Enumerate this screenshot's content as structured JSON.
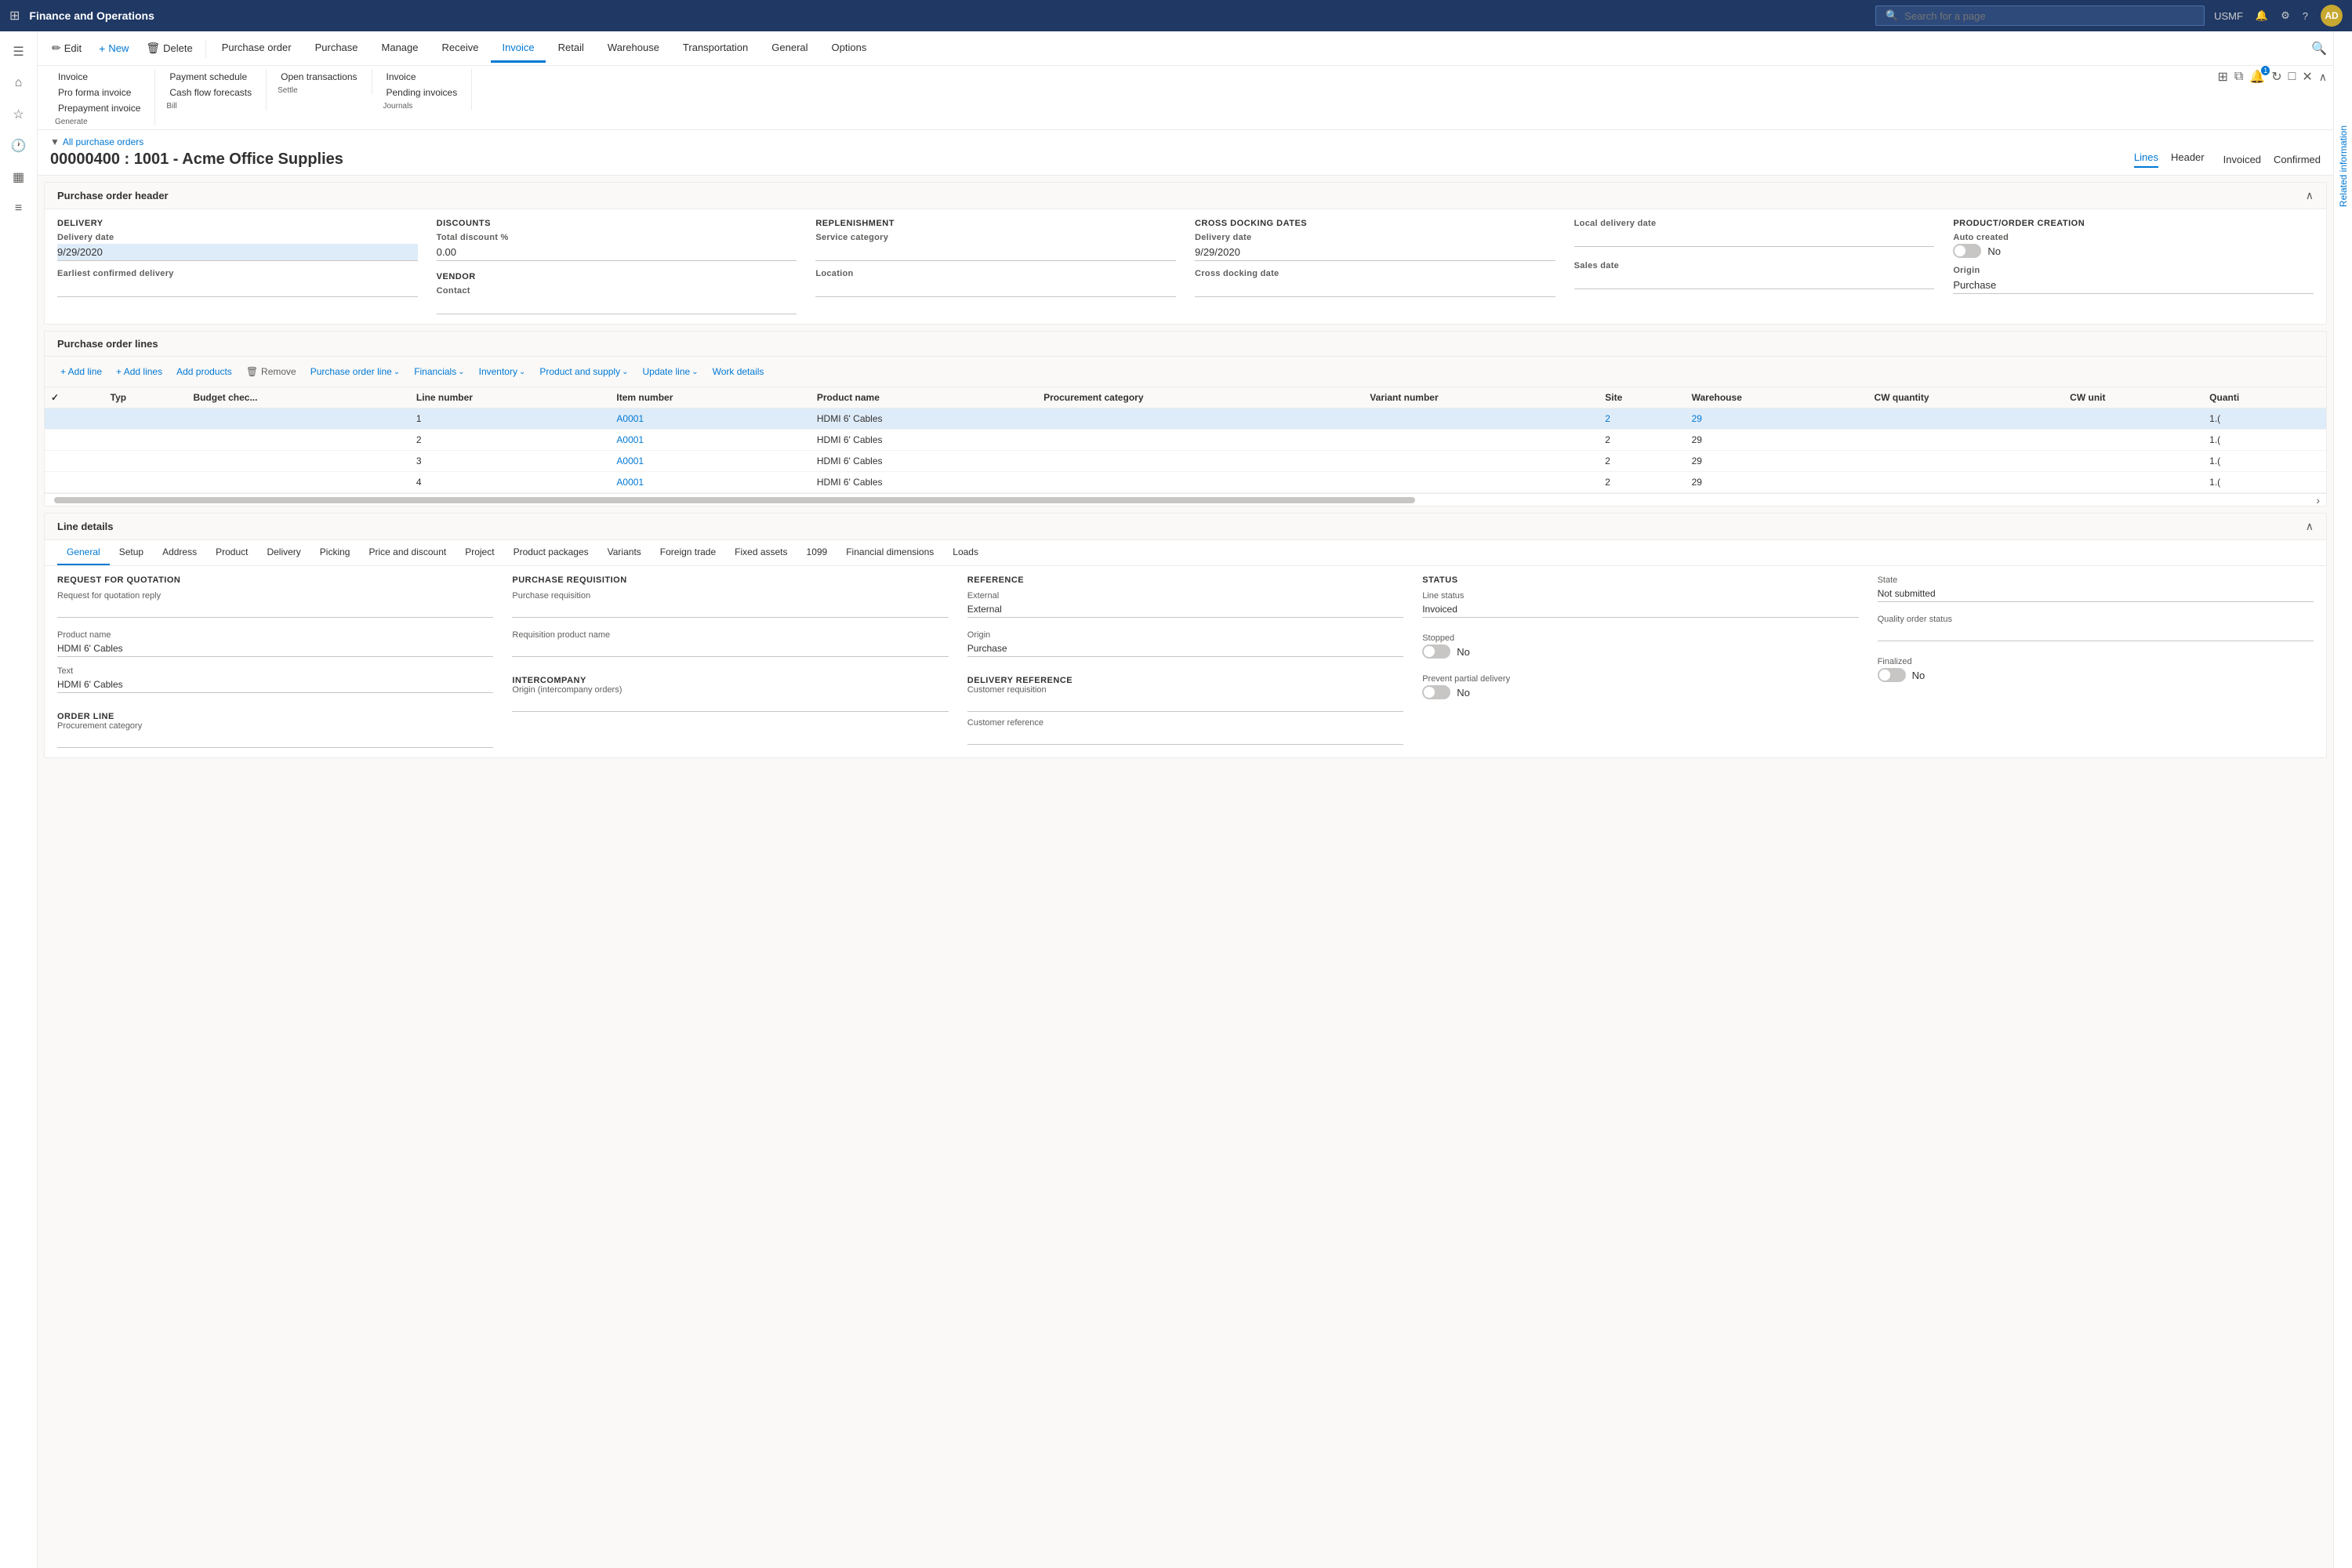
{
  "app": {
    "title": "Finance and Operations",
    "environment": "USMF"
  },
  "search": {
    "placeholder": "Search for a page"
  },
  "command_bar": {
    "edit": "Edit",
    "new": "New",
    "delete": "Delete",
    "purchase_order": "Purchase order",
    "purchase": "Purchase",
    "manage": "Manage",
    "receive": "Receive",
    "invoice": "Invoice",
    "retail": "Retail",
    "warehouse": "Warehouse",
    "transportation": "Transportation",
    "general": "General",
    "options": "Options"
  },
  "ribbon": {
    "groups": [
      {
        "label": "Generate",
        "items": [
          "Invoice",
          "Pro forma invoice",
          "Prepayment invoice"
        ]
      },
      {
        "label": "Bill",
        "items": [
          "Payment schedule",
          "Cash flow forecasts"
        ]
      },
      {
        "label": "Settle",
        "items": [
          "Open transactions"
        ]
      },
      {
        "label": "Journals",
        "items": [
          "Invoice",
          "Pending invoices"
        ]
      }
    ]
  },
  "breadcrumb": "All purchase orders",
  "page_title": "00000400 : 1001 - Acme Office Supplies",
  "title_tabs": [
    "Lines",
    "Header"
  ],
  "status": {
    "invoiced": "Invoiced",
    "confirmed": "Confirmed"
  },
  "purchase_order_header": {
    "title": "Purchase order header",
    "delivery": {
      "label": "DELIVERY",
      "delivery_date_label": "Delivery date",
      "delivery_date_value": "9/29/2020",
      "earliest_confirmed_label": "Earliest confirmed delivery"
    },
    "discounts": {
      "label": "DISCOUNTS",
      "total_discount_label": "Total discount %",
      "total_discount_value": "0.00"
    },
    "vendor": {
      "label": "VENDOR",
      "contact_label": "Contact"
    },
    "replenishment": {
      "label": "REPLENISHMENT",
      "service_category_label": "Service category",
      "location_label": "Location"
    },
    "cross_docking": {
      "label": "CROSS DOCKING DATES",
      "delivery_date_label": "Delivery date",
      "delivery_date_value": "9/29/2020",
      "cross_docking_date_label": "Cross docking date"
    },
    "local_delivery": {
      "label": "Local delivery date"
    },
    "sales_date": {
      "label": "Sales date"
    },
    "product_order_creation": {
      "label": "PRODUCT/ORDER CREATION",
      "auto_created_label": "Auto created",
      "auto_created_value": "No",
      "origin_label": "Origin",
      "origin_value": "Purchase"
    }
  },
  "po_lines": {
    "title": "Purchase order lines",
    "toolbar": {
      "add_line": "+ Add line",
      "add_lines": "+ Add lines",
      "add_products": "Add products",
      "remove": "Remove",
      "purchase_order_line": "Purchase order line",
      "financials": "Financials",
      "inventory": "Inventory",
      "product_and_supply": "Product and supply",
      "update_line": "Update line",
      "work_details": "Work details"
    },
    "columns": [
      "",
      "Typ",
      "Budget chec...",
      "Line number",
      "Item number",
      "Product name",
      "Procurement category",
      "Variant number",
      "Site",
      "Warehouse",
      "CW quantity",
      "CW unit",
      "Quanti"
    ],
    "rows": [
      {
        "selected": true,
        "typ": "",
        "budget": "",
        "line_number": "1",
        "item_number": "A0001",
        "product_name": "HDMI 6' Cables",
        "procurement_category": "",
        "variant_number": "",
        "site": "2",
        "warehouse": "29",
        "cw_quantity": "",
        "cw_unit": "",
        "quantity": "1.("
      },
      {
        "selected": false,
        "typ": "",
        "budget": "",
        "line_number": "2",
        "item_number": "A0001",
        "product_name": "HDMI 6' Cables",
        "procurement_category": "",
        "variant_number": "",
        "site": "2",
        "warehouse": "29",
        "cw_quantity": "",
        "cw_unit": "",
        "quantity": "1.("
      },
      {
        "selected": false,
        "typ": "",
        "budget": "",
        "line_number": "3",
        "item_number": "A0001",
        "product_name": "HDMI 6' Cables",
        "procurement_category": "",
        "variant_number": "",
        "site": "2",
        "warehouse": "29",
        "cw_quantity": "",
        "cw_unit": "",
        "quantity": "1.("
      },
      {
        "selected": false,
        "typ": "",
        "budget": "",
        "line_number": "4",
        "item_number": "A0001",
        "product_name": "HDMI 6' Cables",
        "procurement_category": "",
        "variant_number": "",
        "site": "2",
        "warehouse": "29",
        "cw_quantity": "",
        "cw_unit": "",
        "quantity": "1.("
      }
    ]
  },
  "line_details": {
    "title": "Line details",
    "tabs": [
      "General",
      "Setup",
      "Address",
      "Product",
      "Delivery",
      "Picking",
      "Price and discount",
      "Project",
      "Product packages",
      "Variants",
      "Foreign trade",
      "Fixed assets",
      "1099",
      "Financial dimensions",
      "Loads"
    ],
    "general": {
      "request_for_quotation": {
        "label": "REQUEST FOR QUOTATION",
        "rfq_reply_label": "Request for quotation reply"
      },
      "product_name_label": "Product name",
      "product_name_value": "HDMI 6' Cables",
      "text_label": "Text",
      "text_value": "HDMI 6' Cables",
      "order_line": {
        "label": "ORDER LINE",
        "procurement_category_label": "Procurement category"
      },
      "purchase_requisition": {
        "label": "PURCHASE REQUISITION",
        "purchase_req_label": "Purchase requisition",
        "req_product_name_label": "Requisition product name"
      },
      "intercompany": {
        "label": "INTERCOMPANY",
        "origin_label": "Origin (intercompany orders)"
      },
      "reference": {
        "label": "REFERENCE",
        "external_label": "External",
        "external_value": "External",
        "origin_label": "Origin",
        "origin_value": "Purchase"
      },
      "delivery_reference": {
        "label": "DELIVERY REFERENCE",
        "customer_req_label": "Customer requisition",
        "customer_ref_label": "Customer reference"
      },
      "status": {
        "label": "STATUS",
        "line_status_label": "Line status",
        "line_status_value": "Invoiced",
        "stopped_label": "Stopped",
        "stopped_value": "No",
        "prevent_partial_label": "Prevent partial delivery",
        "prevent_partial_value": "No"
      },
      "state": {
        "state_label": "State",
        "state_value": "Not submitted",
        "quality_order_label": "Quality order status",
        "finalized_label": "Finalized",
        "finalized_value": "No"
      }
    }
  },
  "related_info": "Related information",
  "icons": {
    "grid": "⊞",
    "home": "🏠",
    "bookmark": "☆",
    "recent": "🕐",
    "table": "▦",
    "list": "≡",
    "hamburger": "≡",
    "filter": "▼",
    "search": "🔍",
    "bell": "🔔",
    "gear": "⚙",
    "help": "?",
    "edit": "✏",
    "new": "+",
    "delete": "🗑",
    "collapse": "∧",
    "expand": "∨",
    "scroll_up": "∧",
    "scroll_down": "∨",
    "scroll_right": "›",
    "chevron_right": "›",
    "chevron_down": "⌄",
    "check": "✓"
  }
}
